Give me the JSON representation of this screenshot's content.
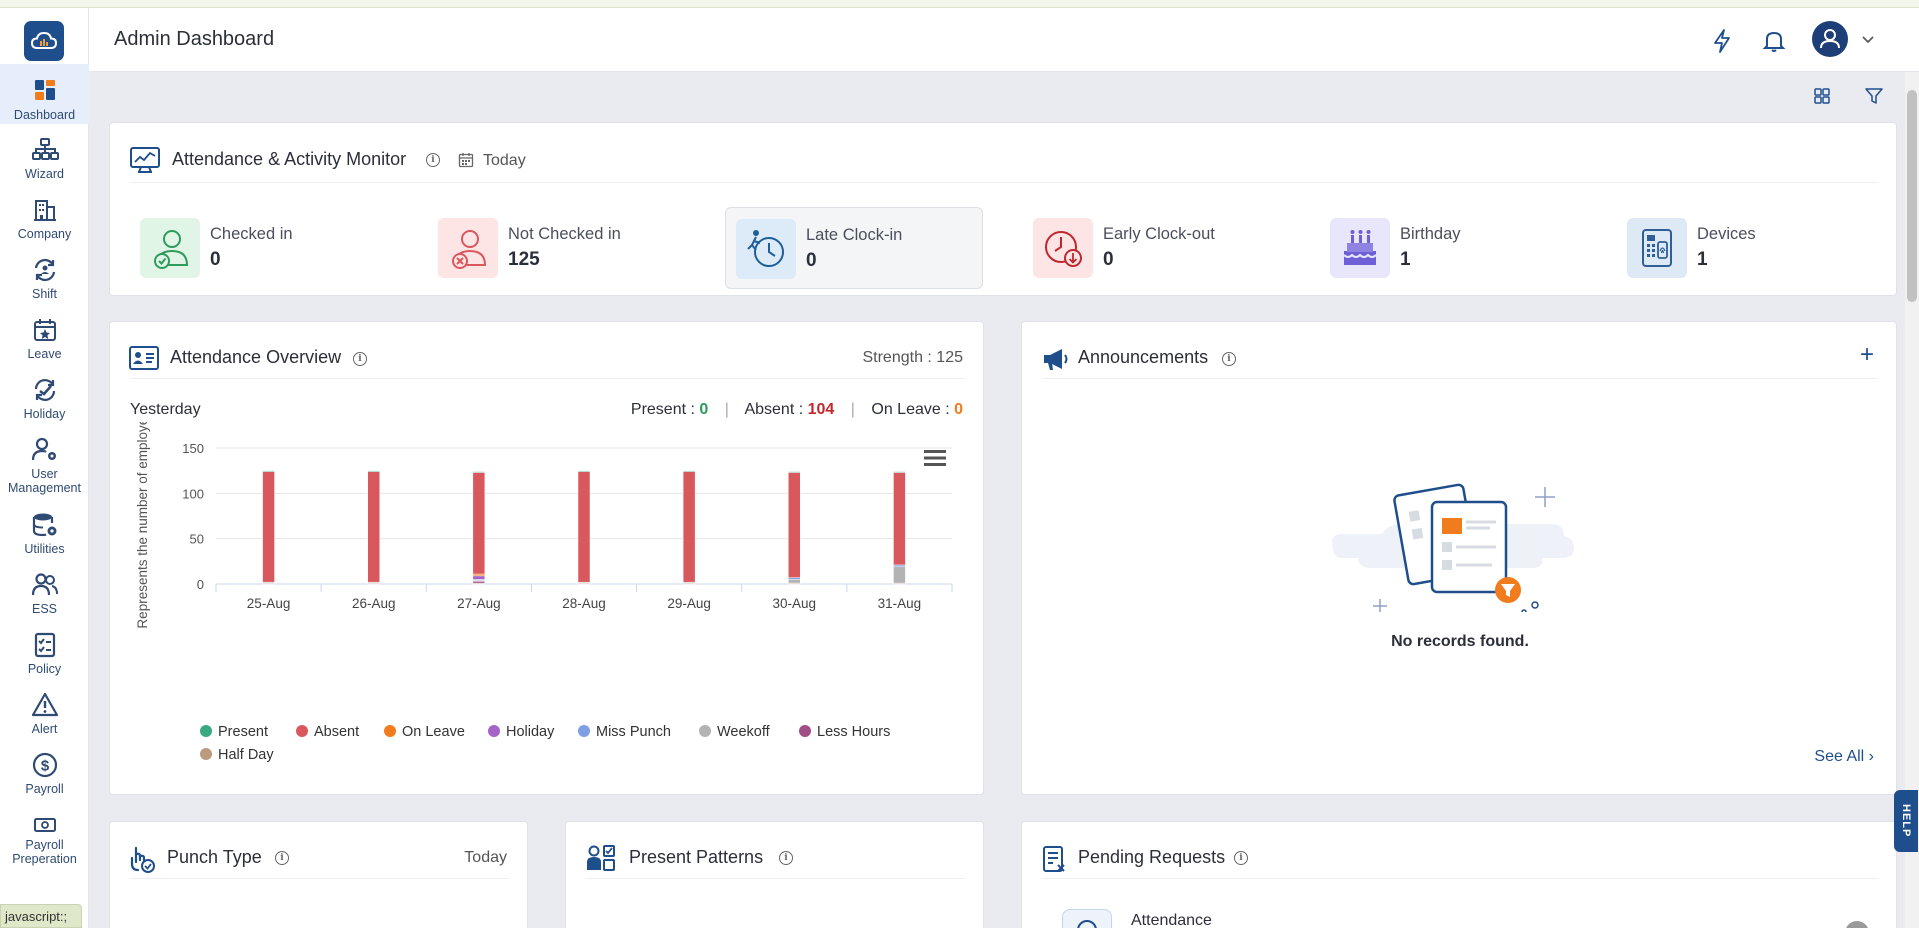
{
  "header": {
    "title": "Admin Dashboard"
  },
  "sidebar": {
    "items": [
      {
        "label": "Dashboard",
        "icon": "dashboard-icon"
      },
      {
        "label": "Wizard",
        "icon": "wizard-icon"
      },
      {
        "label": "Company",
        "icon": "company-icon"
      },
      {
        "label": "Shift",
        "icon": "shift-icon"
      },
      {
        "label": "Leave",
        "icon": "leave-icon"
      },
      {
        "label": "Holiday",
        "icon": "holiday-icon"
      },
      {
        "label": "User",
        "label2": "Management",
        "icon": "user-management-icon"
      },
      {
        "label": "Utilities",
        "icon": "utilities-icon"
      },
      {
        "label": "ESS",
        "icon": "ess-icon"
      },
      {
        "label": "Policy",
        "icon": "policy-icon"
      },
      {
        "label": "Alert",
        "icon": "alert-icon"
      },
      {
        "label": "Payroll",
        "icon": "payroll-icon"
      },
      {
        "label": "Payroll",
        "label2": "Preperation",
        "icon": "payroll-preparation-icon"
      }
    ]
  },
  "status_tip": "javascript:;",
  "help_label": "HELP",
  "monitor": {
    "title": "Attendance & Activity Monitor",
    "period": "Today",
    "stats": [
      {
        "label": "Checked in",
        "value": "0"
      },
      {
        "label": "Not Checked in",
        "value": "125"
      },
      {
        "label": "Late Clock-in",
        "value": "0"
      },
      {
        "label": "Early Clock-out",
        "value": "0"
      },
      {
        "label": "Birthday",
        "value": "1"
      },
      {
        "label": "Devices",
        "value": "1"
      }
    ]
  },
  "overview": {
    "title": "Attendance Overview",
    "strength_label": "Strength : 125",
    "day": "Yesterday",
    "present_label": "Present : ",
    "present_value": "0",
    "absent_label": "Absent : ",
    "absent_value": "104",
    "leave_label": "On Leave : ",
    "leave_value": "0",
    "sep": "|"
  },
  "chart_data": {
    "type": "bar",
    "stacked": true,
    "categories": [
      "25-Aug",
      "26-Aug",
      "27-Aug",
      "28-Aug",
      "29-Aug",
      "30-Aug",
      "31-Aug"
    ],
    "ylabel": "Represents the number of employees",
    "ylim": [
      0,
      150
    ],
    "yticks": [
      0,
      50,
      100,
      150
    ],
    "grid": true,
    "legend_position": "bottom-left",
    "series": [
      {
        "name": "Present",
        "color": "#3aa982",
        "values": [
          1,
          1,
          1,
          1,
          1,
          1,
          1
        ]
      },
      {
        "name": "Absent",
        "color": "#d9585e",
        "values": [
          122,
          122,
          112,
          122,
          122,
          116,
          102
        ]
      },
      {
        "name": "On Leave",
        "color": "#f07c1e",
        "values": [
          0,
          0,
          2,
          0,
          0,
          0,
          0
        ]
      },
      {
        "name": "Holiday",
        "color": "#a664c9",
        "values": [
          0,
          0,
          4,
          0,
          0,
          0,
          0
        ]
      },
      {
        "name": "Miss Punch",
        "color": "#7e9fe3",
        "values": [
          0,
          0,
          1,
          0,
          0,
          2,
          2
        ]
      },
      {
        "name": "Weekoff",
        "color": "#b3b3b3",
        "values": [
          1,
          1,
          1,
          1,
          1,
          4,
          18
        ]
      },
      {
        "name": "Less Hours",
        "color": "#a04d88",
        "values": [
          0,
          0,
          2,
          0,
          0,
          0,
          0
        ]
      },
      {
        "name": "Half Day",
        "color": "#bb9a7e",
        "values": [
          1,
          1,
          1,
          1,
          1,
          1,
          1
        ]
      }
    ]
  },
  "announcements": {
    "title": "Announcements",
    "add_label": "+",
    "empty_text": "No records found.",
    "see_all": "See All ›"
  },
  "punch_type": {
    "title": "Punch Type",
    "period": "Today"
  },
  "present_patterns": {
    "title": "Present Patterns"
  },
  "pending_requests": {
    "title": "Pending Requests",
    "first_item": "Attendance"
  },
  "colors": {
    "brand": "#1f4e8c",
    "present": "#2e9a5c",
    "absent": "#c0282e",
    "leave": "#f07c1e"
  }
}
